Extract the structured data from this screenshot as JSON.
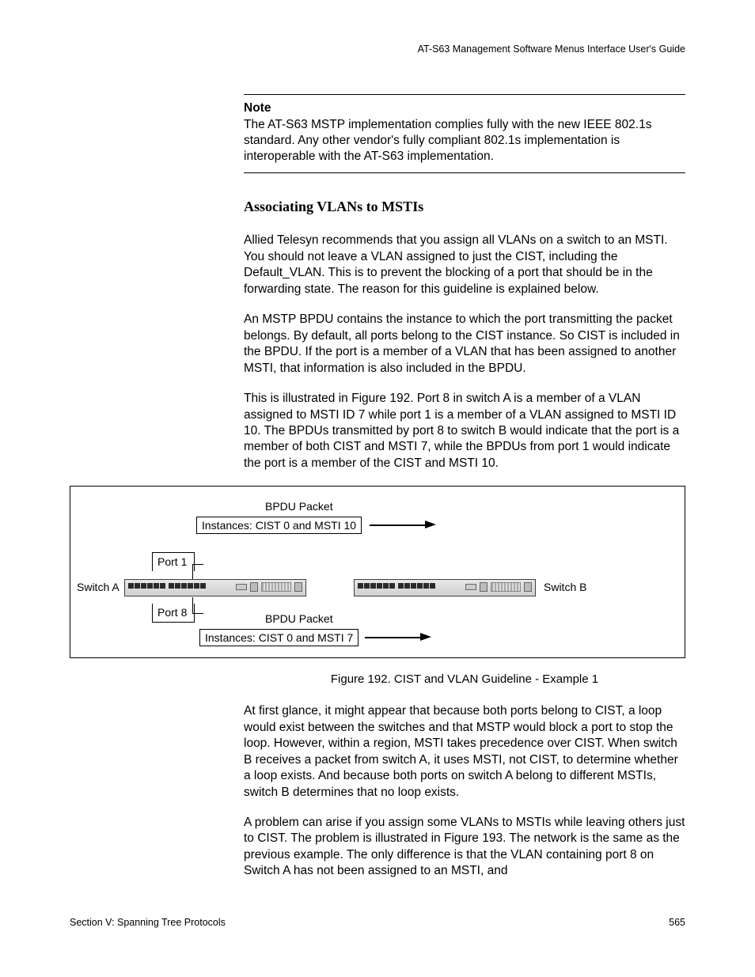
{
  "header": {
    "running_head": "AT-S63 Management Software Menus Interface User's Guide"
  },
  "note": {
    "label": "Note",
    "text": "The AT-S63 MSTP implementation complies fully with the new IEEE 802.1s standard. Any other vendor's fully compliant 802.1s implementation is interoperable with the AT-S63 implementation."
  },
  "subheading": "Associating VLANs to MSTIs",
  "paragraphs": {
    "p1": "Allied Telesyn recommends that you assign all VLANs on a switch to an MSTI. You should not leave a VLAN assigned to just the CIST, including the Default_VLAN. This is to prevent the blocking of a port that should be in the forwarding state. The reason for this guideline is explained below.",
    "p2": "An MSTP BPDU contains the instance to which the port transmitting the packet belongs. By default, all ports belong to the CIST instance. So CIST is included in the BPDU. If the port is a member of a VLAN that has been assigned to another MSTI, that information is also included in the BPDU.",
    "p3": "This is illustrated in Figure 192. Port 8 in switch A is a member of a VLAN assigned to MSTI ID 7 while port 1 is a member of a VLAN assigned to MSTI ID 10. The BPDUs transmitted by port 8 to switch B would indicate that the port is a member of both CIST and MSTI 7, while the BPDUs from port 1 would indicate the port is a member of the CIST and MSTI 10.",
    "p4": "At first glance, it might appear that because both ports belong to CIST, a loop would exist between the switches and that MSTP would block a port to stop the loop. However, within a region, MSTI takes precedence over CIST. When switch B receives a packet from switch A, it uses MSTI, not CIST, to determine whether a loop exists. And because both ports on switch A belong to different MSTIs, switch B determines that no loop exists.",
    "p5": "A problem can arise if you assign some VLANs to MSTIs while leaving others just to CIST. The problem is illustrated in Figure 193. The network is the same as the previous example. The only difference is that the VLAN containing port 8 on Switch A has not been assigned to an MSTI, and"
  },
  "figure": {
    "bpdu_top_label": "BPDU Packet",
    "bpdu_top_instances": "Instances: CIST 0 and MSTI 10",
    "bpdu_bot_label": "BPDU Packet",
    "bpdu_bot_instances": "Instances: CIST 0 and MSTI 7",
    "port1": "Port 1",
    "port8": "Port 8",
    "switch_a": "Switch A",
    "switch_b": "Switch B",
    "caption": "Figure 192. CIST and VLAN Guideline - Example 1"
  },
  "footer": {
    "section": "Section V: Spanning Tree Protocols",
    "page": "565"
  }
}
